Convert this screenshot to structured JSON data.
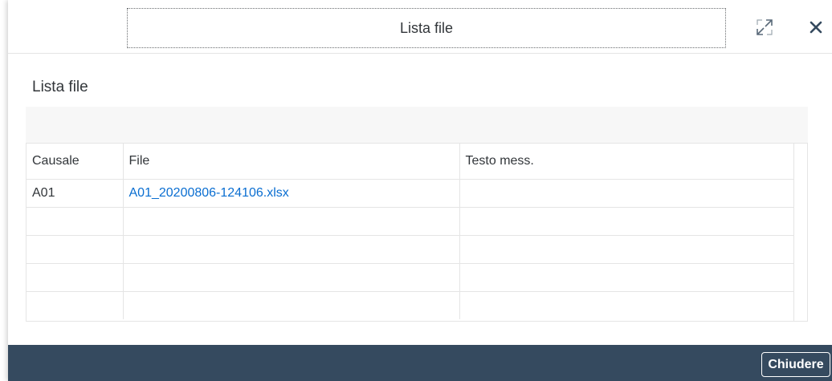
{
  "dialog": {
    "title": "Lista file",
    "expand_icon": "expand-icon",
    "close_icon": "close-icon"
  },
  "section": {
    "title": "Lista file"
  },
  "table": {
    "columns": [
      "Causale",
      "File",
      "Testo mess."
    ],
    "rows": [
      {
        "causale": "A01",
        "file": "A01_20200806-124106.xlsx",
        "testo": ""
      },
      {
        "causale": "",
        "file": "",
        "testo": ""
      },
      {
        "causale": "",
        "file": "",
        "testo": ""
      },
      {
        "causale": "",
        "file": "",
        "testo": ""
      },
      {
        "causale": "",
        "file": "",
        "testo": ""
      }
    ]
  },
  "footer": {
    "close_label": "Chiudere"
  },
  "colors": {
    "footer_bg": "#354a5f",
    "link": "#0a6ed1",
    "toolbar_bg": "#f7f7f7"
  }
}
